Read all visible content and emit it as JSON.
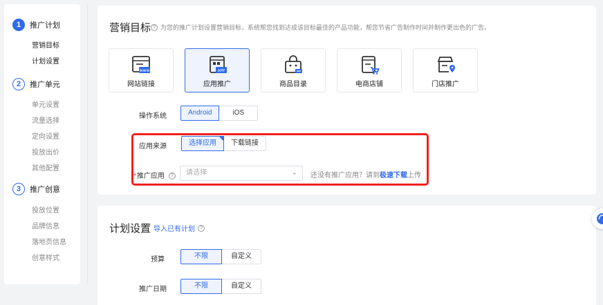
{
  "nav": {
    "steps": [
      {
        "num": "1",
        "title": "推广计划",
        "items": [
          "营销目标",
          "计划设置"
        ]
      },
      {
        "num": "2",
        "title": "推广单元",
        "items": [
          "单元设置",
          "流量选择",
          "定向设置",
          "投放出价",
          "其他配置"
        ]
      },
      {
        "num": "3",
        "title": "推广创意",
        "items": [
          "投放位置",
          "品牌信息",
          "落地页信息",
          "创意样式"
        ]
      }
    ]
  },
  "marketing": {
    "title": "营销目标",
    "help": "?",
    "description": "为您的推广计划设置营销目标，系统帮您找到达成该目标最佳的产品功能，帮您节省广告制作时间并制作更出色的广告。",
    "goals": [
      {
        "label": "网站链接",
        "icon": "website-icon",
        "badge": "www"
      },
      {
        "label": "应用推广",
        "icon": "app-icon",
        "badge": "APP"
      },
      {
        "label": "商品目录",
        "icon": "catalog-icon"
      },
      {
        "label": "电商店铺",
        "icon": "ecommerce-store-icon"
      },
      {
        "label": "门店推广",
        "icon": "store-location-icon"
      }
    ],
    "selected_goal": "应用推广"
  },
  "os": {
    "label": "操作系统",
    "options": [
      "Android",
      "iOS"
    ],
    "selected": "Android"
  },
  "app_source": {
    "label": "应用来源",
    "options": [
      "选择应用",
      "下载链接"
    ],
    "selected": "选择应用"
  },
  "promo_app": {
    "label": "推广应用",
    "required_mark": "*",
    "help": "?",
    "placeholder": "请选择",
    "hint_prefix": "还没有推广应用？请到",
    "hint_link": "极速下载",
    "hint_suffix": "上传"
  },
  "plan": {
    "title": "计划设置",
    "import_link": "导入已有计划",
    "help": "?",
    "budget": {
      "label": "预算",
      "options": [
        "不限",
        "自定义"
      ],
      "selected": "不限"
    },
    "date": {
      "label": "推广日期",
      "options": [
        "不限",
        "自定义"
      ],
      "selected": "不限"
    }
  },
  "colors": {
    "accent": "#2f6bea",
    "highlight": "#f0201a"
  }
}
